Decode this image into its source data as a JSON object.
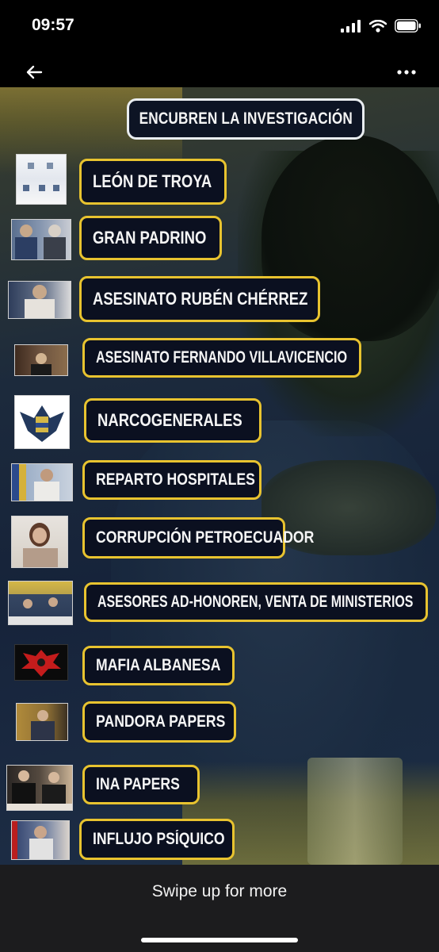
{
  "status": {
    "time": "09:57"
  },
  "nav": {
    "back_icon": "arrow-left-icon",
    "more_icon": "ellipsis-icon"
  },
  "post": {
    "title": "ENCUBREN LA INVESTIGACIÓN",
    "items": [
      {
        "label": "LEÓN DE TROYA",
        "thumb_colors": [
          "#f4f6f8",
          "#7b8ea8"
        ]
      },
      {
        "label": "GRAN PADRINO",
        "thumb_colors": [
          "#5a6f8f",
          "#c9ccd3"
        ]
      },
      {
        "label": "ASESINATO RUBÉN CHÉRREZ",
        "thumb_colors": [
          "#2e3d5b",
          "#c7a88a"
        ]
      },
      {
        "label": "ASESINATO FERNANDO VILLAVICENCIO",
        "thumb_colors": [
          "#3e2a1e",
          "#8b6d4c"
        ]
      },
      {
        "label": "NARCOGENERALES",
        "thumb_colors": [
          "#ffffff",
          "#23395d"
        ]
      },
      {
        "label": "REPARTO HOSPITALES",
        "thumb_colors": [
          "#2b4a8c",
          "#d5b13b"
        ]
      },
      {
        "label": "CORRUPCIÓN PETROECUADOR",
        "thumb_colors": [
          "#e7e3de",
          "#5d3b2a"
        ]
      },
      {
        "label": "ASESORES AD-HONOREN, VENTA DE MINISTERIOS",
        "thumb_colors": [
          "#d4b746",
          "#364763"
        ]
      },
      {
        "label": "MAFIA ALBANESA",
        "thumb_colors": [
          "#0b0b0b",
          "#c41c1c"
        ]
      },
      {
        "label": "PANDORA PAPERS",
        "thumb_colors": [
          "#b08a3a",
          "#3c3122"
        ]
      },
      {
        "label": "INA PAPERS",
        "thumb_colors": [
          "#2a2624",
          "#c9b295"
        ]
      },
      {
        "label": "INFLUJO PSÍQUICO",
        "thumb_colors": [
          "#3a4b74",
          "#d9d2cb"
        ]
      }
    ]
  },
  "footer": {
    "swipe_text": "Swipe up for more"
  }
}
